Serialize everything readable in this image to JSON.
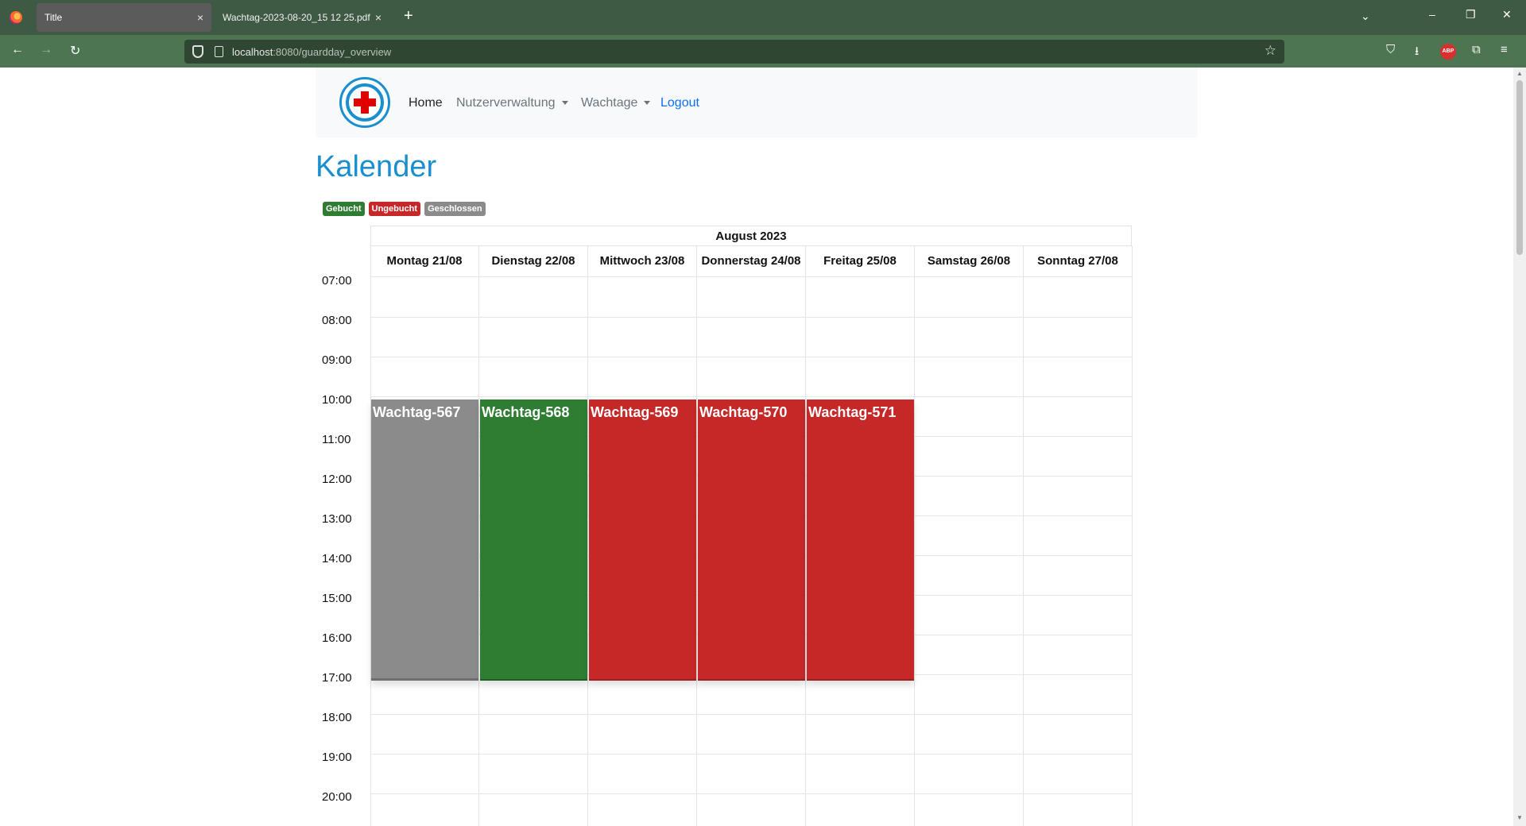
{
  "browser": {
    "tabs": [
      {
        "title": "Title",
        "active": true
      },
      {
        "title": "Wachtag-2023-08-20_15 12 25.pdf",
        "active": false
      }
    ],
    "url_host": "localhost",
    "url_rest": ":8080/guardday_overview",
    "icons": {
      "tab_close": "×",
      "new_tab": "+",
      "list_tabs": "⌄",
      "minimize": "–",
      "restore": "❐",
      "close": "✕",
      "back": "←",
      "forward": "→",
      "reload": "↻",
      "bookmark": "☆",
      "pocket": "⛉",
      "download": "⭳",
      "extensions": "⧉",
      "menu": "≡",
      "abp": "ABP"
    }
  },
  "site_nav": {
    "items": [
      "Home",
      "Nutzerverwaltung",
      "Wachtage",
      "Logout"
    ]
  },
  "page": {
    "title": "Kalender",
    "legend": [
      {
        "label": "Gebucht",
        "color": "#2e7d32"
      },
      {
        "label": "Ungebucht",
        "color": "#c62828"
      },
      {
        "label": "Geschlossen",
        "color": "#8b8b8b"
      }
    ]
  },
  "calendar": {
    "month": "August 2023",
    "days": [
      "Montag 21/08",
      "Dienstag 22/08",
      "Mittwoch 23/08",
      "Donnerstag 24/08",
      "Freitag 25/08",
      "Samstag 26/08",
      "Sonntag 27/08"
    ],
    "times": [
      "07:00",
      "08:00",
      "09:00",
      "10:00",
      "11:00",
      "12:00",
      "13:00",
      "14:00",
      "15:00",
      "16:00",
      "17:00",
      "18:00",
      "19:00",
      "20:00"
    ],
    "events": [
      {
        "title": "Wachtag-567",
        "day": "Montag 21/08",
        "start": "10:00",
        "end": "17:00",
        "status": "Geschlossen",
        "color": "#8b8b8b"
      },
      {
        "title": "Wachtag-568",
        "day": "Dienstag 22/08",
        "start": "10:00",
        "end": "17:00",
        "status": "Gebucht",
        "color": "#2e7d32"
      },
      {
        "title": "Wachtag-569",
        "day": "Mittwoch 23/08",
        "start": "10:00",
        "end": "17:00",
        "status": "Ungebucht",
        "color": "#c62828"
      },
      {
        "title": "Wachtag-570",
        "day": "Donnerstag 24/08",
        "start": "10:00",
        "end": "17:00",
        "status": "Ungebucht",
        "color": "#c62828"
      },
      {
        "title": "Wachtag-571",
        "day": "Freitag 25/08",
        "start": "10:00",
        "end": "17:00",
        "status": "Ungebucht",
        "color": "#c62828"
      }
    ]
  }
}
